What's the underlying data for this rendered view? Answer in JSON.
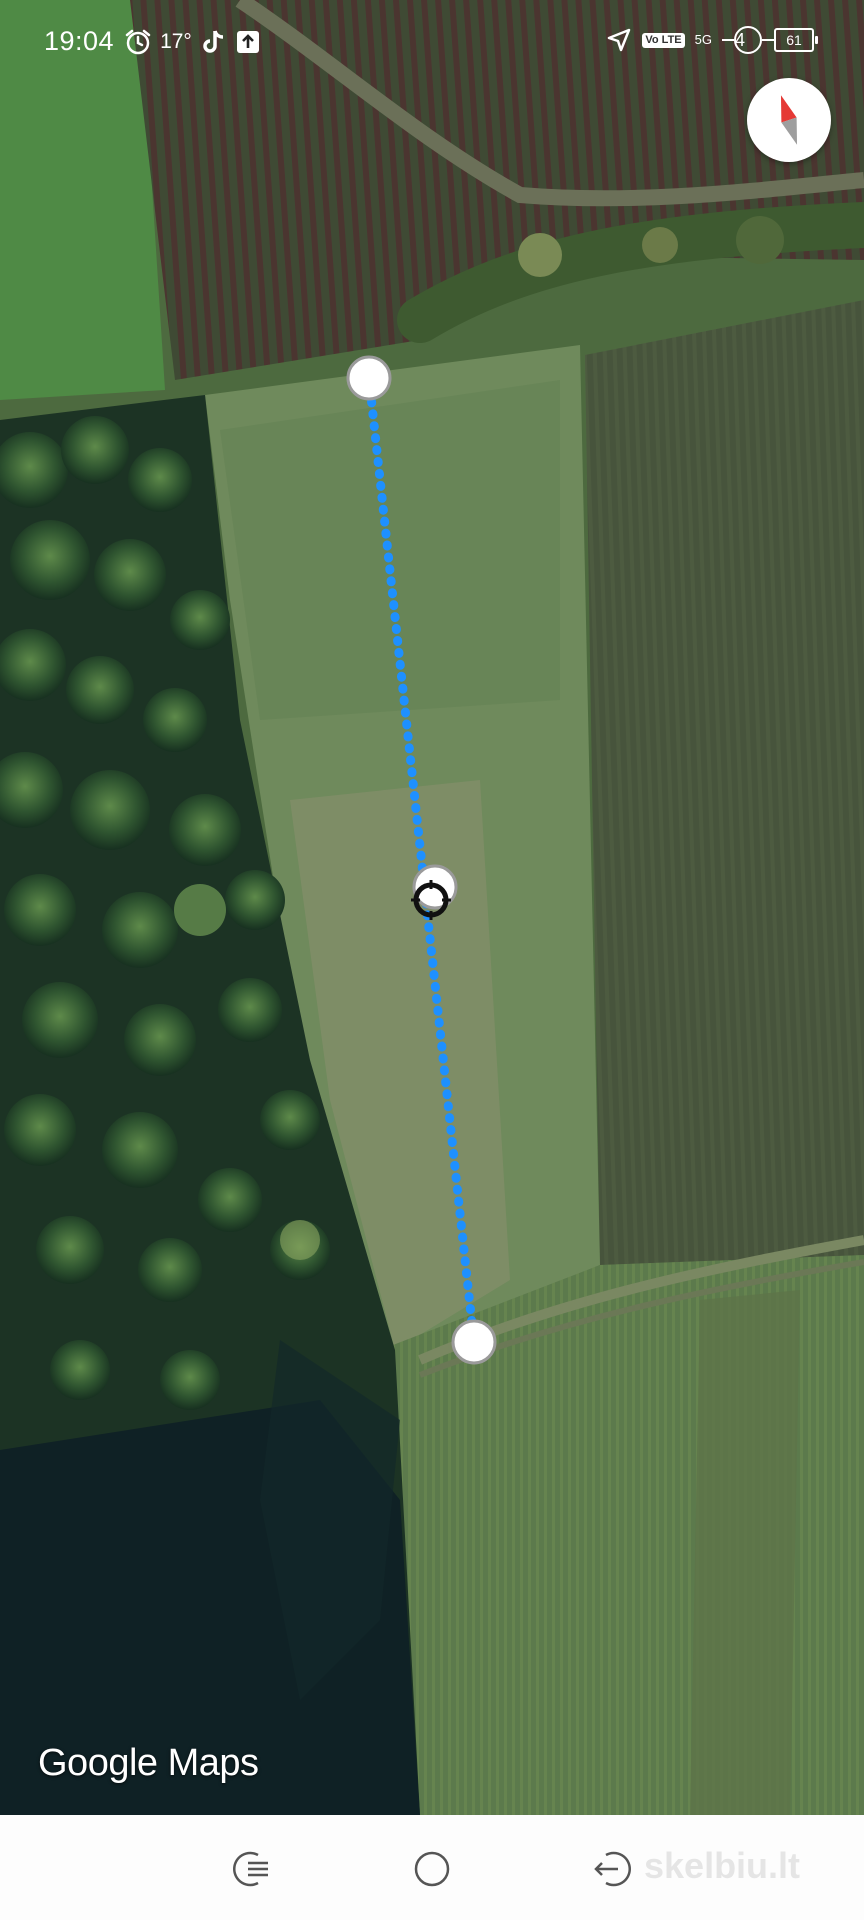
{
  "status_bar": {
    "time": "19:04",
    "temperature": "17°",
    "volte_label": "Vo LTE",
    "network_label": "5G",
    "sim_label": "4",
    "battery_level": "61",
    "icons": [
      "alarm-icon",
      "tiktok-icon",
      "upload-icon",
      "location-arrow-icon",
      "signal-icon"
    ]
  },
  "map": {
    "type": "satellite",
    "colors": {
      "route": "#1e90ff",
      "marker_fill": "#ffffff",
      "marker_stroke": "#9a9a9a"
    },
    "markers": [
      "start-point",
      "midpoint-crosshair",
      "end-point"
    ],
    "compass_icon": "compass-icon",
    "attribution": "Google Maps"
  },
  "nav_bar": {
    "buttons": [
      "recents-button",
      "home-button",
      "back-button"
    ]
  },
  "watermark": "skelbiu.lt"
}
